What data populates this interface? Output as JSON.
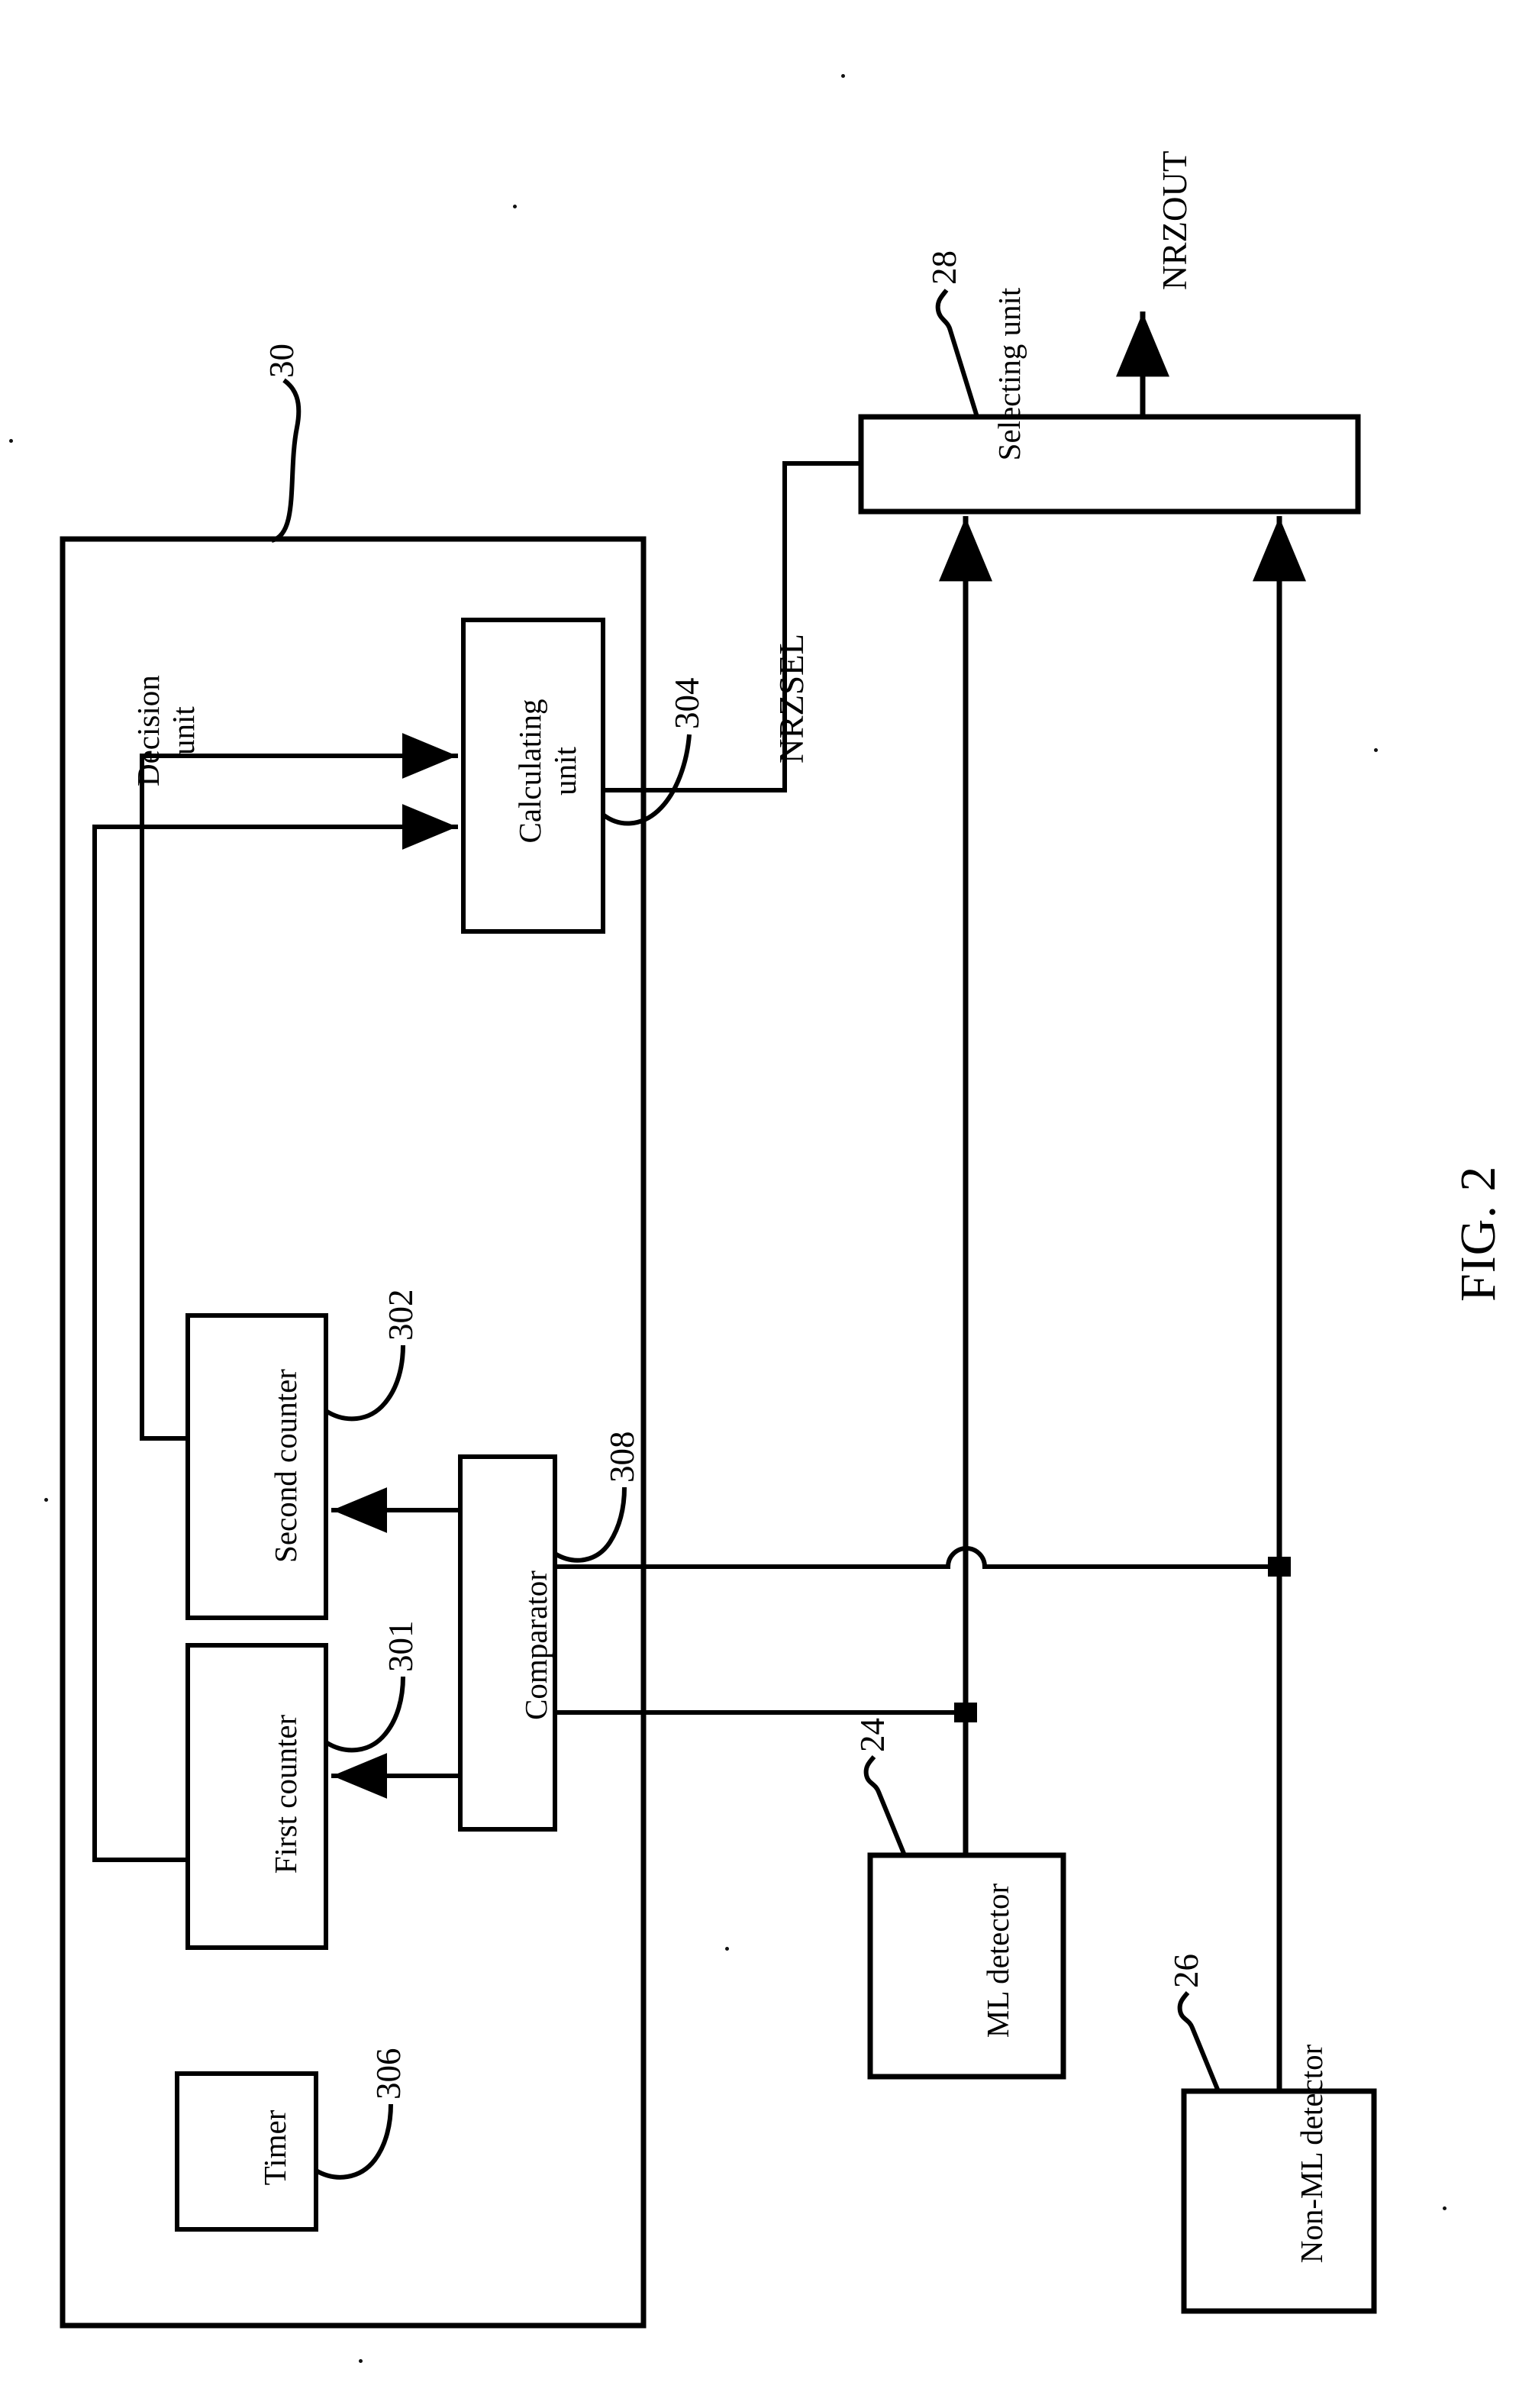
{
  "figure": {
    "caption": "FIG. 2"
  },
  "blocks": [
    {
      "key": "decision_unit",
      "label": "Decision\nunit",
      "ref": "30"
    },
    {
      "key": "calculating_unit",
      "label": "Calculating\nunit",
      "ref": "304"
    },
    {
      "key": "second_counter",
      "label": "Second counter",
      "ref": "302"
    },
    {
      "key": "first_counter",
      "label": "First counter",
      "ref": "301"
    },
    {
      "key": "comparator",
      "label": "Comparator",
      "ref": "308"
    },
    {
      "key": "timer",
      "label": "Timer",
      "ref": "306"
    },
    {
      "key": "selecting_unit",
      "label": "Selecting unit",
      "ref": "28"
    },
    {
      "key": "ml_detector",
      "label": "ML detector",
      "ref": "24"
    },
    {
      "key": "non_ml_detector",
      "label": "Non-ML detector",
      "ref": "26"
    }
  ],
  "labels": {
    "decision_unit_line1": "Decision",
    "decision_unit_line2": "unit",
    "calculating_unit_line1": "Calculating",
    "calculating_unit_line2": "unit",
    "second_counter": "Second counter",
    "first_counter": "First counter",
    "comparator": "Comparator",
    "timer": "Timer",
    "selecting_unit": "Selecting unit",
    "ml_detector": "ML detector",
    "non_ml_detector": "Non-ML detector"
  },
  "refs": {
    "decision_unit": "30",
    "calculating_unit": "304",
    "second_counter": "302",
    "first_counter": "301",
    "comparator": "308",
    "timer": "306",
    "selecting_unit": "28",
    "ml_detector": "24",
    "non_ml_detector": "26"
  },
  "signals": {
    "nrzsel": "NRZSEL",
    "nrzout": "NRZOUT"
  },
  "colors": {
    "ink": "#000000",
    "paper": "#ffffff"
  }
}
